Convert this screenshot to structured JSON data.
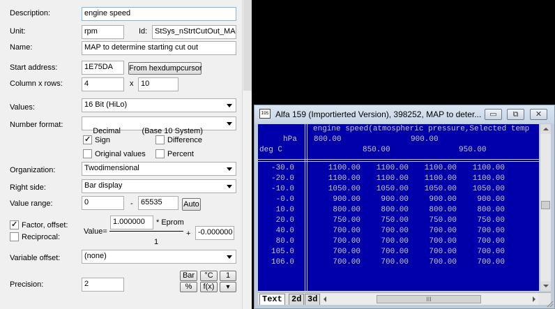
{
  "form": {
    "description": {
      "label": "Description:",
      "value": "engine speed"
    },
    "unit": {
      "label": "Unit:",
      "value": "rpm"
    },
    "id": {
      "label": "Id:",
      "value": "StSys_nStrtCutOut_MAP"
    },
    "name": {
      "label": "Name:",
      "value": "MAP to determine starting cut out"
    },
    "start_address": {
      "label": "Start address:",
      "value": "1E75DA",
      "button": "From hexdumpcursor"
    },
    "column_rows": {
      "label": "Column x rows:",
      "columns": "4",
      "x": "x",
      "rows": "10"
    },
    "values": {
      "label": "Values:",
      "selected": "16 Bit (HiLo)"
    },
    "number_format": {
      "label": "Number format:",
      "selected": "Decimal          (Base 10 System)"
    },
    "sign": {
      "label": "Sign",
      "checked": true
    },
    "difference": {
      "label": "Difference",
      "checked": false
    },
    "original_values": {
      "label": "Original values",
      "checked": false
    },
    "percent": {
      "label": "Percent",
      "checked": false
    },
    "organization": {
      "label": "Organization:",
      "selected": "Twodimensional"
    },
    "right_side": {
      "label": "Right side:",
      "selected": "Bar display"
    },
    "value_range": {
      "label": "Value range:",
      "min": "0",
      "dash": "-",
      "max": "65535",
      "auto_button": "Auto"
    },
    "factor_offset": {
      "label": "Factor, offset:",
      "checked": true
    },
    "reciprocal": {
      "label": "Reciprocal:",
      "checked": false
    },
    "formula": {
      "value_label": "Value=",
      "factor": "1.000000",
      "eprom_label": "* Eprom",
      "divisor": "1",
      "plus": "+",
      "offset": "-0.000000"
    },
    "variable_offset": {
      "label": "Variable offset:",
      "selected": "(none)"
    },
    "precision": {
      "label": "Precision:",
      "value": "2"
    },
    "unit_buttons": {
      "bar": "Bar",
      "celsius": "°C",
      "one": "1",
      "percent": "%",
      "fx": "f(x)",
      "down": "▼"
    }
  },
  "map_window": {
    "title": "Alfa 159 (Importierted Version), 398252, MAP to deter...",
    "icon_text": "IOS",
    "buttons": {
      "minimize": "▭",
      "restore": "⧉",
      "close": "✕"
    },
    "header_title": "engine speed(atmospheric pressure,Selected temp",
    "x_axis_unit": "hPa",
    "y_axis_unit": "deg C",
    "x_axis_row1": [
      "800.00",
      "900.00"
    ],
    "x_axis_row2": [
      "850.00",
      "950.00"
    ],
    "row_labels": [
      "-30.0",
      "-20.0",
      "-10.0",
      "-0.0",
      "10.0",
      "20.0",
      "40.0",
      "80.0",
      "105.0",
      "106.0"
    ],
    "cells": [
      [
        "1100.00",
        "1100.00",
        "1100.00",
        "1100.00"
      ],
      [
        "1100.00",
        "1100.00",
        "1100.00",
        "1100.00"
      ],
      [
        "1050.00",
        "1050.00",
        "1050.00",
        "1050.00"
      ],
      [
        "900.00",
        "900.00",
        "900.00",
        "900.00"
      ],
      [
        "800.00",
        "800.00",
        "800.00",
        "800.00"
      ],
      [
        "750.00",
        "750.00",
        "750.00",
        "750.00"
      ],
      [
        "700.00",
        "700.00",
        "700.00",
        "700.00"
      ],
      [
        "700.00",
        "700.00",
        "700.00",
        "700.00"
      ],
      [
        "700.00",
        "700.00",
        "700.00",
        "700.00"
      ],
      [
        "700.00",
        "700.00",
        "700.00",
        "700.00"
      ]
    ],
    "tabs": [
      "Text",
      "2d",
      "3d"
    ],
    "active_tab": "Text",
    "scroll_thumb_glyph": "III",
    "colors": {
      "map_background": "#0000aa",
      "map_text": "#c8c8c8",
      "title_bar": "#c6d5e6"
    }
  }
}
